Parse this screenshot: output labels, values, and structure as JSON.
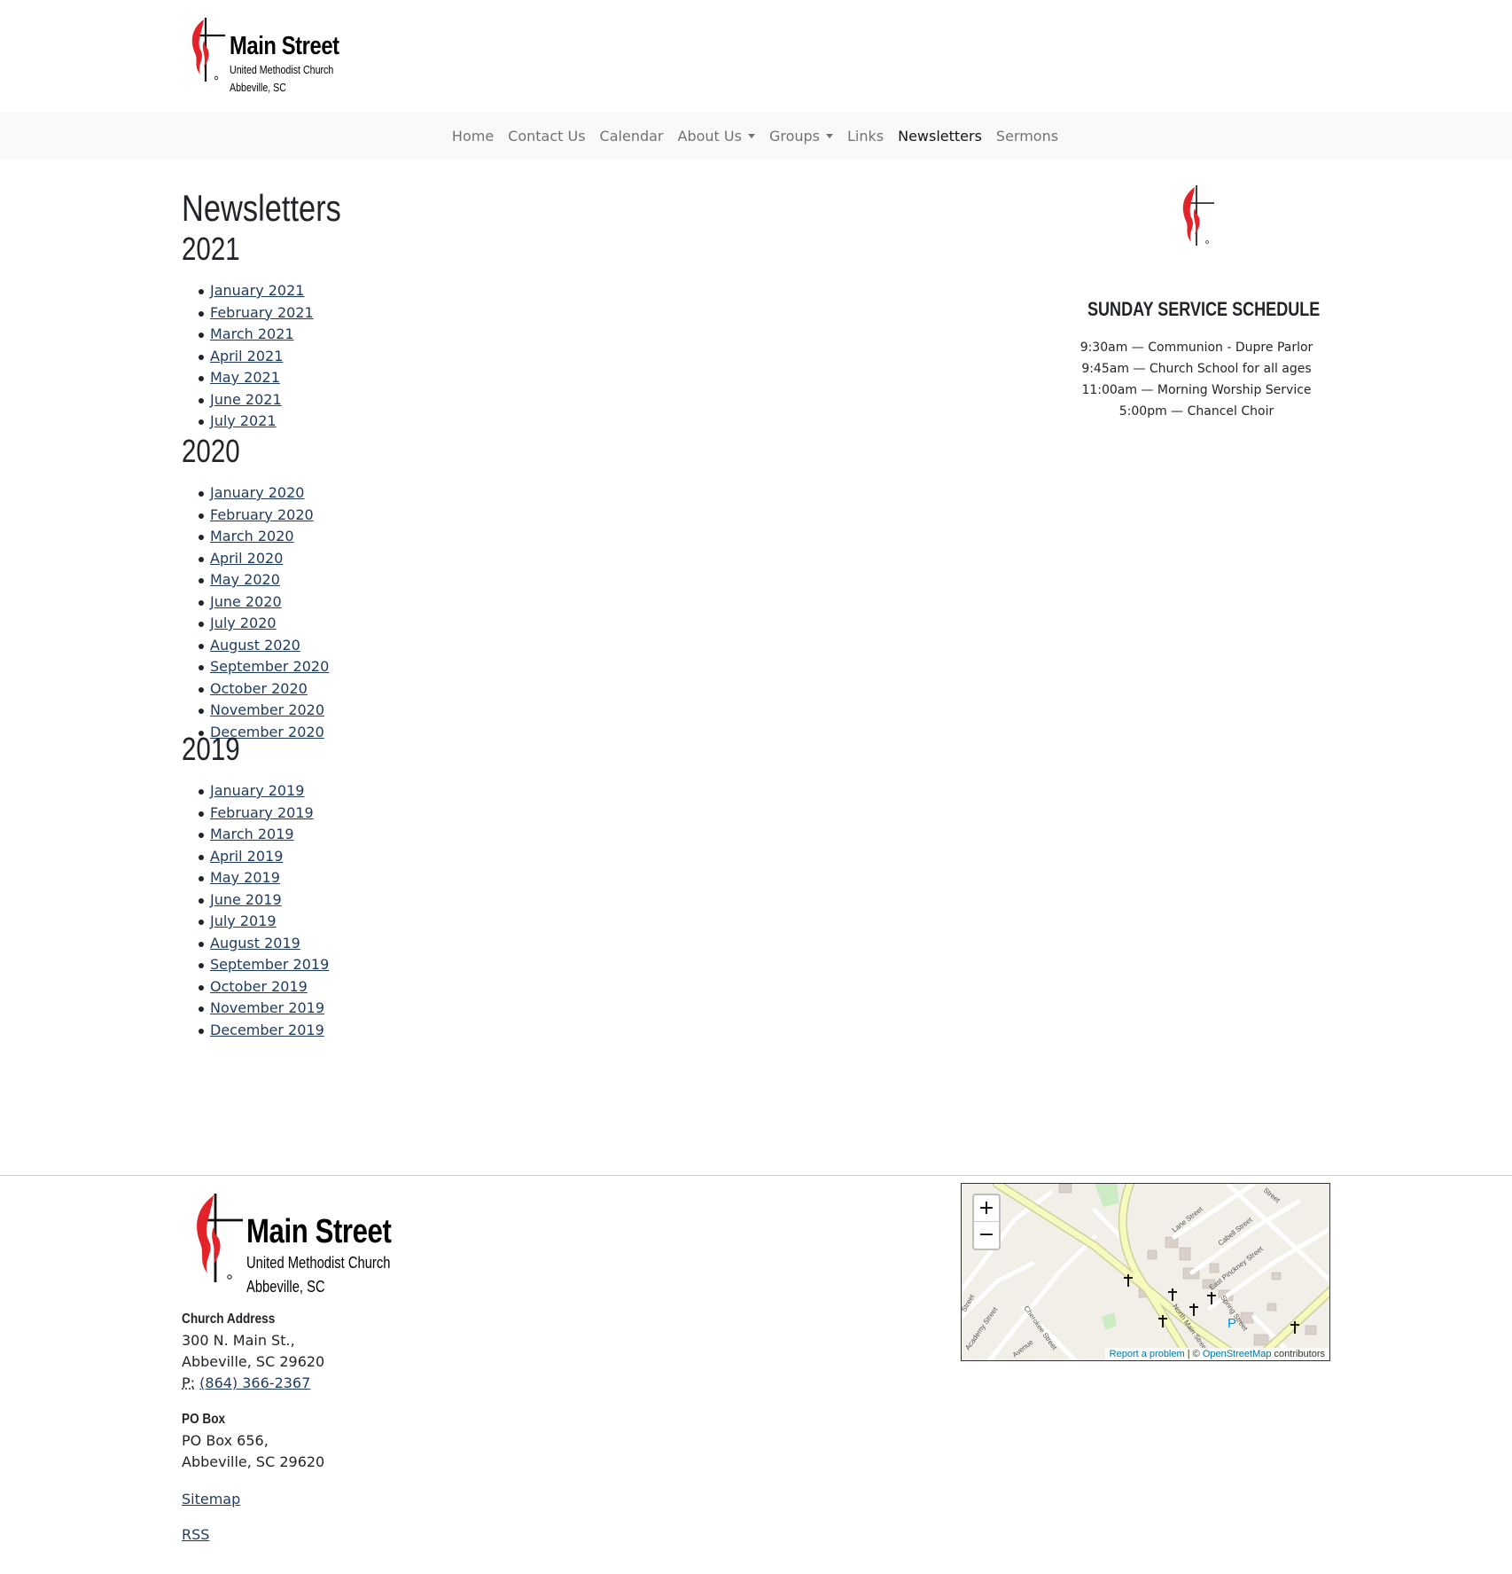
{
  "header": {
    "logo": {
      "name": "Main Street",
      "line1": "United Methodist Church",
      "line2": "Abbeville, SC"
    }
  },
  "nav": {
    "items": [
      {
        "label": "Home",
        "dropdown": false,
        "active": false
      },
      {
        "label": "Contact Us",
        "dropdown": false,
        "active": false
      },
      {
        "label": "Calendar",
        "dropdown": false,
        "active": false
      },
      {
        "label": "About Us",
        "dropdown": true,
        "active": false
      },
      {
        "label": "Groups",
        "dropdown": true,
        "active": false
      },
      {
        "label": "Links",
        "dropdown": false,
        "active": false
      },
      {
        "label": "Newsletters",
        "dropdown": false,
        "active": true
      },
      {
        "label": "Sermons",
        "dropdown": false,
        "active": false
      }
    ]
  },
  "main": {
    "title": "Newsletters",
    "years": [
      {
        "year": "2021",
        "items": [
          "January 2021",
          "February 2021",
          "March 2021",
          "April 2021",
          "May 2021",
          "June 2021",
          "July 2021"
        ]
      },
      {
        "year": "2020",
        "items": [
          "January 2020",
          "February 2020",
          "March 2020",
          "April 2020",
          "May 2020",
          "June 2020",
          "July 2020",
          "August 2020",
          "September 2020",
          "October 2020",
          "November 2020",
          "December 2020"
        ]
      },
      {
        "year": "2019",
        "items": [
          "January 2019",
          "February 2019",
          "March 2019",
          "April 2019",
          "May 2019",
          "June 2019",
          "July 2019",
          "August 2019",
          "September 2019",
          "October 2019",
          "November 2019",
          "December 2019"
        ]
      }
    ]
  },
  "sidebar": {
    "schedule_title": "SUNDAY SERVICE SCHEDULE",
    "schedule": [
      "9:30am — Communion - Dupre Parlor",
      "9:45am — Church School for all ages",
      "11:00am — Morning Worship Service",
      "5:00pm — Chancel Choir"
    ]
  },
  "footer": {
    "logo": {
      "name": "Main Street",
      "line1": "United Methodist Church",
      "line2": "Abbeville, SC"
    },
    "church_address": {
      "heading": "Church Address",
      "line1": "300 N. Main St.,",
      "line2": "Abbeville, SC 29620",
      "phone_label": "P:",
      "phone": "(864) 366-2367"
    },
    "po_box": {
      "heading": "PO Box",
      "line1": "PO Box 656,",
      "line2": "Abbeville, SC 29620"
    },
    "sitemap_label": "Sitemap",
    "rss_label": "RSS"
  },
  "map": {
    "zoom_in": "+",
    "zoom_out": "−",
    "report_label": "Report a problem",
    "attribution_sep": " | © ",
    "osm_label": "OpenStreetMap",
    "contributors": " contributors",
    "street_labels": [
      "Lane Street",
      "Cabell Street",
      "East Pinckney Street",
      "Spring Street",
      "North Main Street",
      "Academy Street",
      "Cherokee Street",
      "Avenue",
      "Street",
      "Street"
    ],
    "parking_label": "P"
  },
  "colors": {
    "link": "#1f3a5f",
    "navbar_bg": "#f8f9fa",
    "flame_red": "#e2232a",
    "map_road_yellow": "#f7fabf"
  }
}
